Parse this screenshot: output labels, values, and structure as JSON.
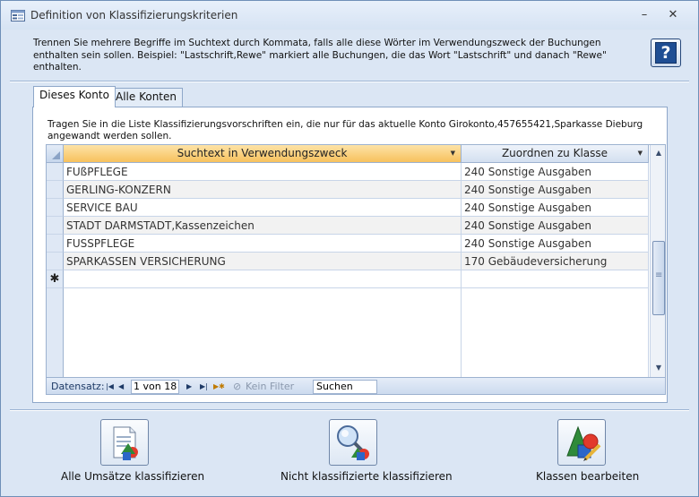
{
  "window": {
    "title": "Definition von Klassifizierungskriterien",
    "minimize_glyph": "–",
    "close_glyph": "✕"
  },
  "help": {
    "text": "Trennen Sie mehrere Begriffe im Suchtext durch Kommata, falls alle diese Wörter im Verwendungszweck der Buchungen enthalten sein sollen. Beispiel: \"Lastschrift,Rewe\" markiert alle Buchungen, die das Wort \"Lastschrift\" und danach \"Rewe\" enthalten.",
    "button_glyph": "?"
  },
  "tabs": [
    {
      "label": "Dieses Konto",
      "active": true
    },
    {
      "label": "Alle Konten",
      "active": false
    }
  ],
  "panel": {
    "text": "Tragen Sie in die Liste Klassifizierungsvorschriften ein, die nur für das aktuelle Konto Girokonto,457655421,Sparkasse Dieburg angewandt werden sollen."
  },
  "grid": {
    "columns": [
      "Suchtext in Verwendungszweck",
      "Zuordnen zu Klasse"
    ],
    "rows": [
      [
        "FUßPFLEGE",
        "240 Sonstige Ausgaben"
      ],
      [
        "GERLING-KONZERN",
        "240 Sonstige Ausgaben"
      ],
      [
        "SERVICE BAU",
        "240 Sonstige Ausgaben"
      ],
      [
        "STADT DARMSTADT,Kassenzeichen",
        "240 Sonstige Ausgaben"
      ],
      [
        "FUSSPFLEGE",
        "240 Sonstige Ausgaben"
      ],
      [
        "SPARKASSEN VERSICHERUNG",
        "170 Gebäudeversicherung"
      ]
    ],
    "new_row_marker": "✱"
  },
  "navigator": {
    "label": "Datensatz:",
    "position": "1 von 18",
    "filter_label": "Kein Filter",
    "search_label": "Suchen"
  },
  "buttons": [
    {
      "label": "Alle Umsätze klassifizieren",
      "icon": "document-classify-icon"
    },
    {
      "label": "Nicht klassifizierte klassifizieren",
      "icon": "magnifier-classify-icon"
    },
    {
      "label": "Klassen bearbeiten",
      "icon": "shapes-edit-icon"
    }
  ],
  "colors": {
    "window_bg": "#dbe6f4",
    "header_highlight": "#f7c15d",
    "help_blue": "#1f4e93"
  }
}
